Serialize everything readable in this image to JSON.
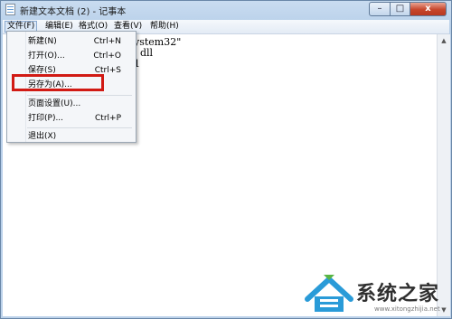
{
  "window": {
    "title": "新建文本文档 (2) - 记事本",
    "icon": "notepad-icon",
    "controls": {
      "minimize": "–",
      "maximize": "□",
      "close": "x"
    }
  },
  "menubar": [
    {
      "label": "文件(F)"
    },
    {
      "label": "编辑(E)"
    },
    {
      "label": "格式(O)"
    },
    {
      "label": "查看(V)"
    },
    {
      "label": "帮助(H)"
    }
  ],
  "editor": {
    "lines": [
      "ystem32\"",
      ". dll",
      "1"
    ]
  },
  "file_menu": {
    "items": [
      {
        "label": "新建(N)",
        "shortcut": "Ctrl+N"
      },
      {
        "label": "打开(O)...",
        "shortcut": "Ctrl+O"
      },
      {
        "label": "保存(S)",
        "shortcut": "Ctrl+S"
      },
      {
        "label": "另存为(A)...",
        "shortcut": ""
      },
      {
        "label": "页面设置(U)...",
        "shortcut": ""
      },
      {
        "label": "打印(P)...",
        "shortcut": "Ctrl+P"
      },
      {
        "label": "退出(X)",
        "shortcut": ""
      }
    ],
    "highlight_color": "#d11a14"
  },
  "watermark": {
    "text": "系统之家",
    "url": "www.xitongzhijia.net"
  }
}
